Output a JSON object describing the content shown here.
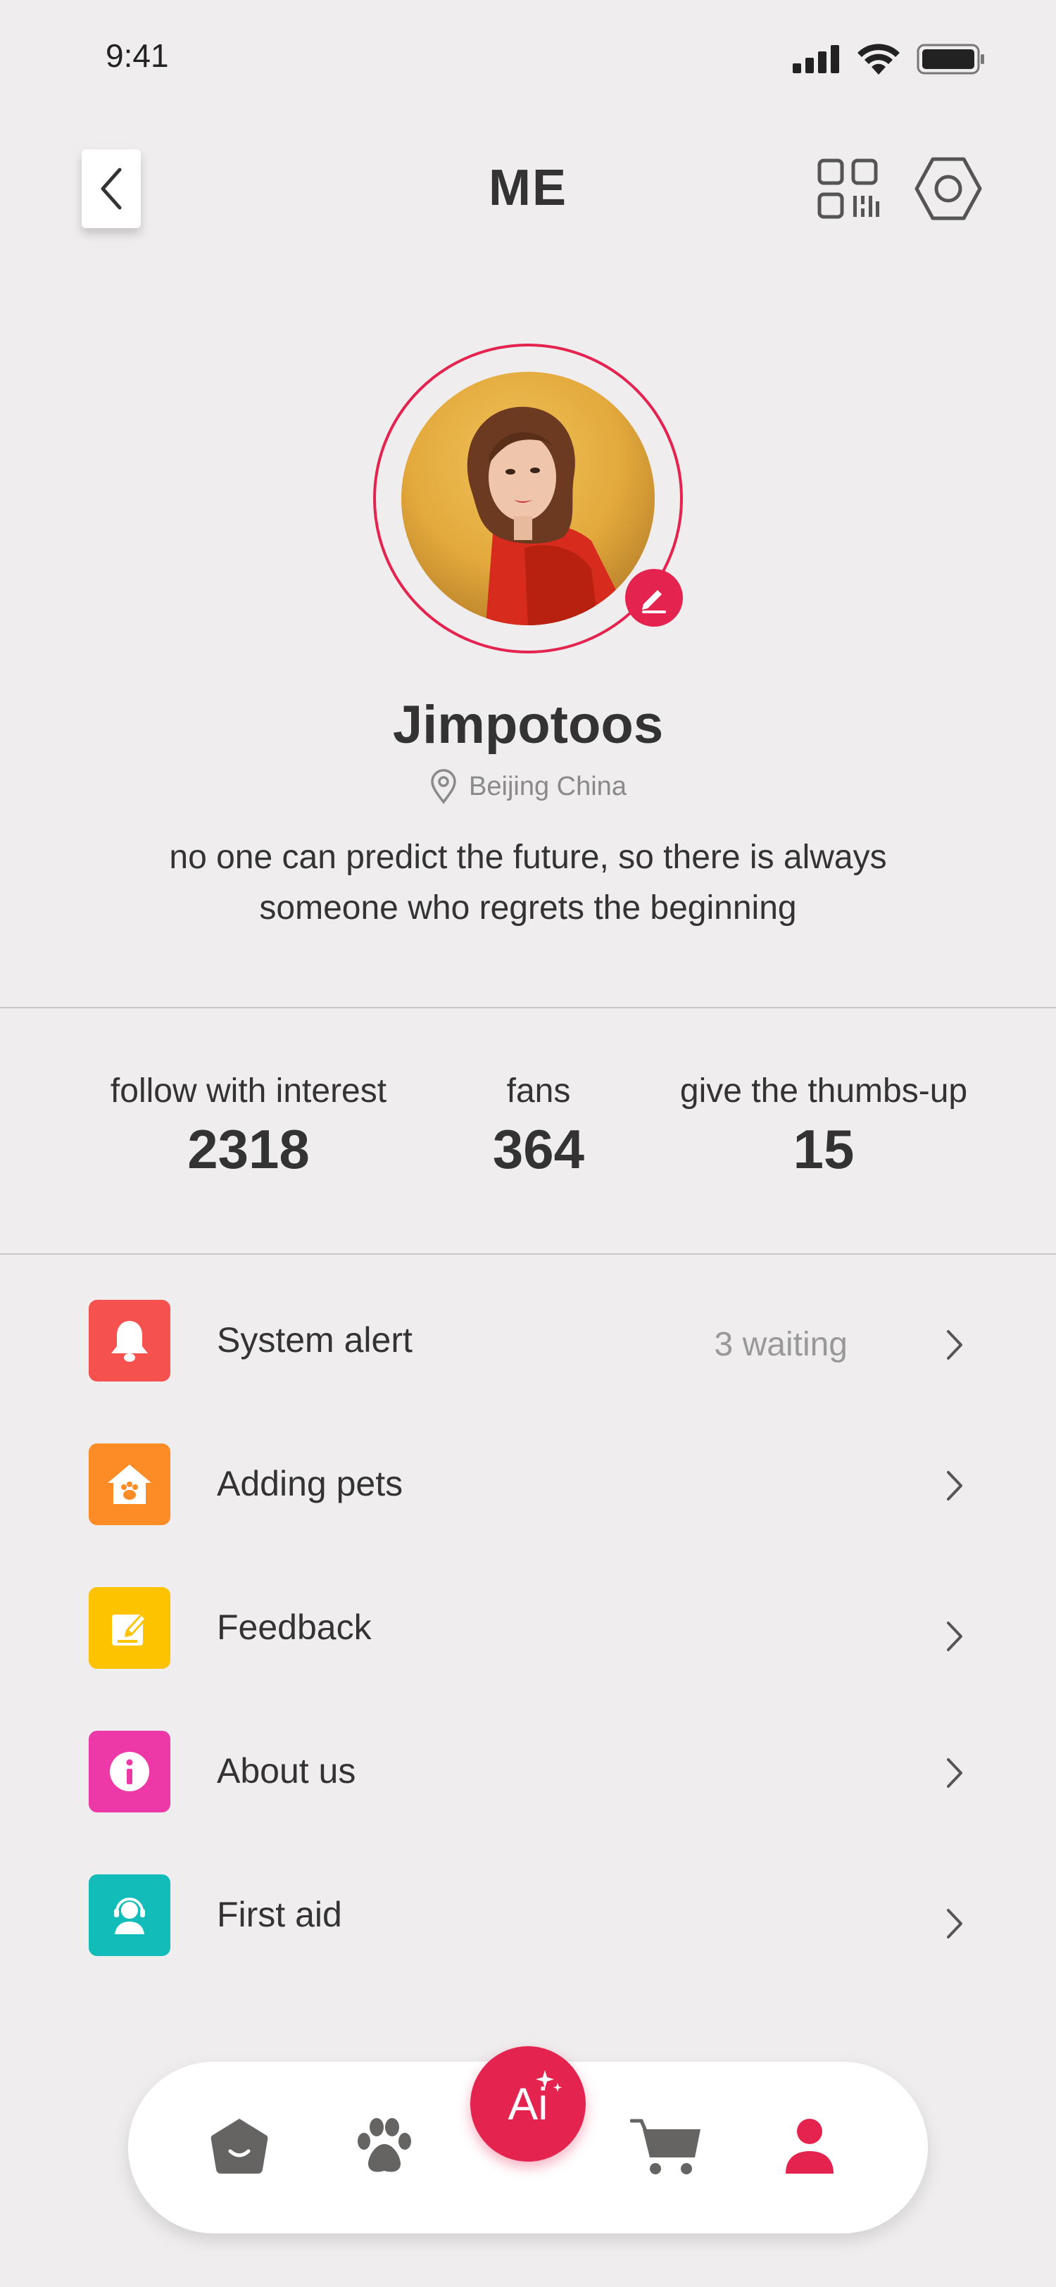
{
  "status_bar": {
    "time": "9:41"
  },
  "header": {
    "title": "ME"
  },
  "profile": {
    "name": "Jimpotoos",
    "location": "Beijing China",
    "bio_line1": "no one can predict the future, so there is always",
    "bio_line2": "someone who regrets the beginning"
  },
  "stats": [
    {
      "label": "follow with interest",
      "value": "2318"
    },
    {
      "label": "fans",
      "value": "364"
    },
    {
      "label": "give the thumbs-up",
      "value": "15"
    }
  ],
  "menu": [
    {
      "label": "System alert",
      "status": "3 waiting",
      "icon": "bell-icon",
      "color": "#f5524f"
    },
    {
      "label": "Adding pets",
      "status": "",
      "icon": "pet-house-icon",
      "color": "#fd8b26"
    },
    {
      "label": "Feedback",
      "status": "",
      "icon": "edit-note-icon",
      "color": "#fdc300"
    },
    {
      "label": "About us",
      "status": "",
      "icon": "info-icon",
      "color": "#ed38a7"
    },
    {
      "label": "First aid",
      "status": "",
      "icon": "support-agent-icon",
      "color": "#11bcb9"
    }
  ],
  "tabbar": {
    "ai_label": "Ai",
    "tabs": [
      "home-icon",
      "paw-icon",
      "ai-icon",
      "cart-icon",
      "profile-icon"
    ],
    "active": "profile-icon"
  },
  "colors": {
    "accent": "#e4234f",
    "background": "#efedee",
    "icon_gray": "#666363"
  }
}
